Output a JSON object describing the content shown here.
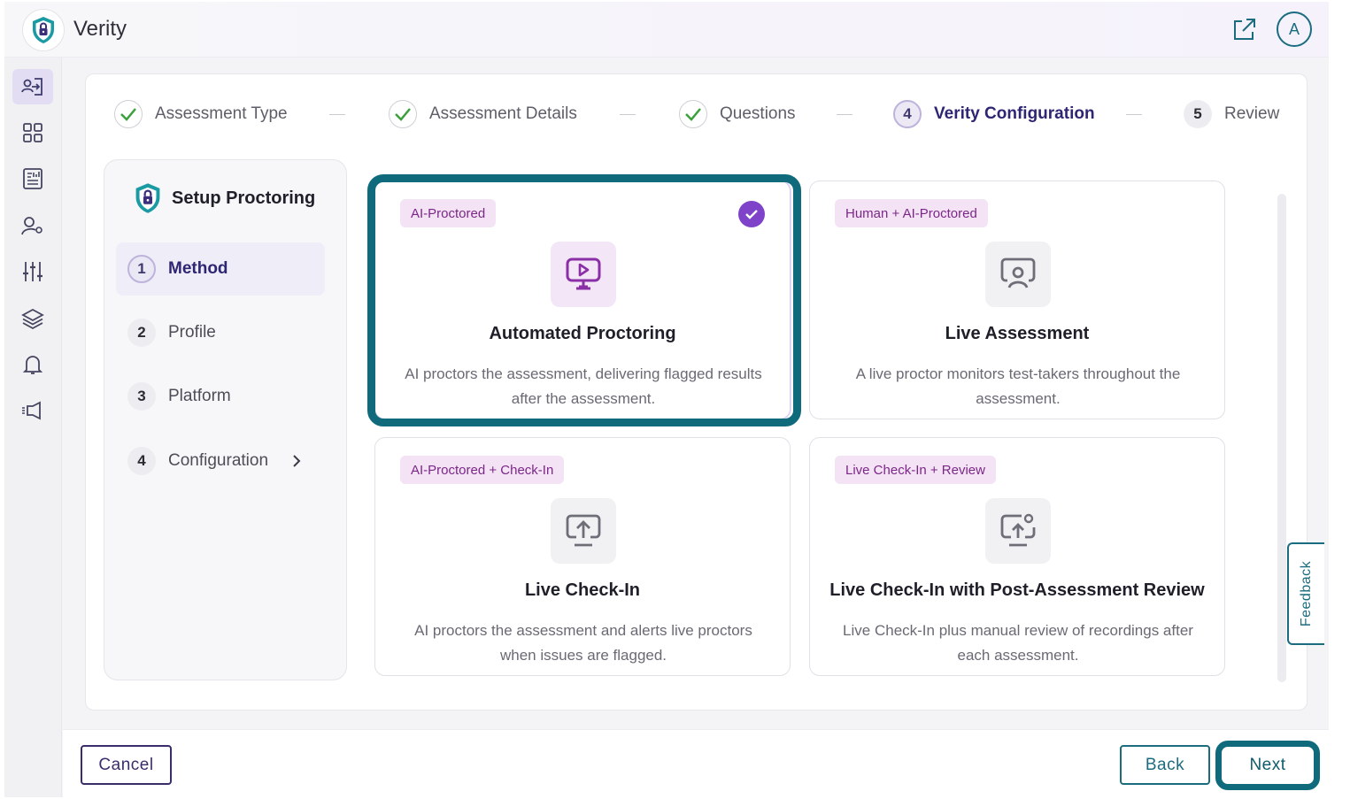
{
  "app": {
    "title": "Verity",
    "avatar_initial": "A"
  },
  "sidebar": [
    {
      "icon": "user-login-icon",
      "active": true
    },
    {
      "icon": "grid-icon",
      "active": false
    },
    {
      "icon": "report-icon",
      "active": false
    },
    {
      "icon": "user-settings-icon",
      "active": false
    },
    {
      "icon": "sliders-icon",
      "active": false
    },
    {
      "icon": "layers-icon",
      "active": false
    },
    {
      "icon": "bell-icon",
      "active": false
    },
    {
      "icon": "megaphone-icon",
      "active": false
    }
  ],
  "stepper": [
    {
      "label": "Assessment Type",
      "status": "done"
    },
    {
      "label": "Assessment Details",
      "status": "done"
    },
    {
      "label": "Questions",
      "status": "done"
    },
    {
      "number": "4",
      "label": "Verity Configuration",
      "status": "current"
    },
    {
      "number": "5",
      "label": "Review",
      "status": "todo"
    }
  ],
  "setup": {
    "title": "Setup Proctoring",
    "items": [
      {
        "number": "1",
        "label": "Method",
        "active": true
      },
      {
        "number": "2",
        "label": "Profile",
        "active": false
      },
      {
        "number": "3",
        "label": "Platform",
        "active": false
      },
      {
        "number": "4",
        "label": "Configuration",
        "active": false
      }
    ]
  },
  "methods": [
    {
      "tag": "AI-Proctored",
      "title": "Automated Proctoring",
      "description": "AI proctors the assessment, delivering flagged results after the assessment.",
      "selected": true,
      "icon": "monitor-play-icon"
    },
    {
      "tag": "Human + AI-Proctored",
      "title": "Live Assessment",
      "description": "A live proctor monitors test-takers throughout the assessment.",
      "selected": false,
      "icon": "monitor-person-icon"
    },
    {
      "tag": "AI-Proctored + Check-In",
      "title": "Live Check-In",
      "description": "AI proctors the assessment and alerts live proctors when issues are flagged.",
      "selected": false,
      "icon": "monitor-upload-icon"
    },
    {
      "tag": "Live Check-In + Review",
      "title": "Live Check-In with Post-Assessment Review",
      "description": "Live Check-In plus manual review of recordings after each assessment.",
      "selected": false,
      "icon": "monitor-upload-search-icon"
    }
  ],
  "feedback_label": "Feedback",
  "footer": {
    "cancel": "Cancel",
    "back": "Back",
    "next": "Next"
  },
  "colors": {
    "accent_purple": "#7e43c8",
    "teal": "#0f6b7c",
    "tag_bg": "#f3e3f4",
    "tag_text": "#7b2788"
  }
}
